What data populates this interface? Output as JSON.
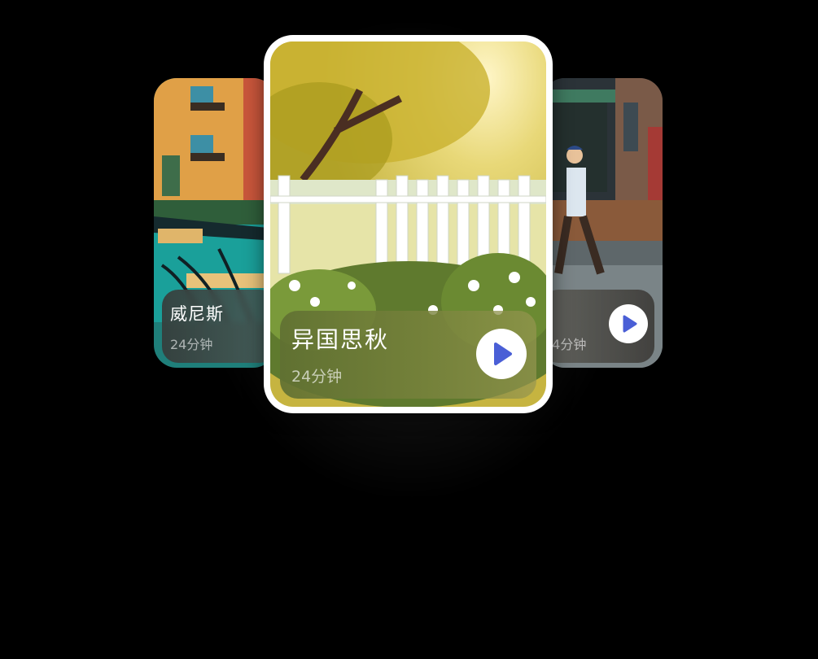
{
  "cards": {
    "left": {
      "title": "威尼斯",
      "duration": "24分钟"
    },
    "main": {
      "title": "异国思秋",
      "duration": "24分钟"
    },
    "right": {
      "duration": "24分钟"
    }
  },
  "icons": {
    "play": "play-icon"
  },
  "colors": {
    "play_triangle": "#4a5fd6",
    "main_panel": "#6f7a3a",
    "background": "#000000"
  }
}
